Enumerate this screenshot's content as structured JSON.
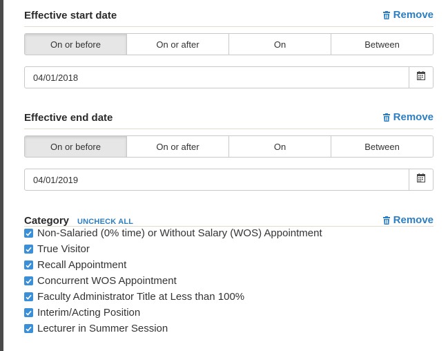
{
  "sections": {
    "start": {
      "title": "Effective start date",
      "remove_label": "Remove",
      "options": [
        "On or before",
        "On or after",
        "On",
        "Between"
      ],
      "active_option": "On or before",
      "date_value": "04/01/2018"
    },
    "end": {
      "title": "Effective end date",
      "remove_label": "Remove",
      "options": [
        "On or before",
        "On or after",
        "On",
        "Between"
      ],
      "active_option": "On or before",
      "date_value": "04/01/2019"
    },
    "category": {
      "title": "Category",
      "uncheck_all_label": "UNCHECK ALL",
      "remove_label": "Remove",
      "items": [
        {
          "label": "Non-Salaried (0% time) or Without Salary (WOS) Appointment",
          "checked": true
        },
        {
          "label": "True Visitor",
          "checked": true
        },
        {
          "label": "Recall Appointment",
          "checked": true
        },
        {
          "label": "Concurrent WOS Appointment",
          "checked": true
        },
        {
          "label": "Faculty Administrator Title at Less than 100%",
          "checked": true
        },
        {
          "label": "Interim/Acting Position",
          "checked": true
        },
        {
          "label": "Lecturer in Summer Session",
          "checked": true
        }
      ]
    }
  },
  "icons": {
    "remove": "trash-icon",
    "calendar": "calendar-icon",
    "checkbox": "checkmark-icon"
  },
  "colors": {
    "accent": "#2b7ec2",
    "checkbox": "#3a8fd6",
    "active_segment": "#e6e6e6"
  }
}
